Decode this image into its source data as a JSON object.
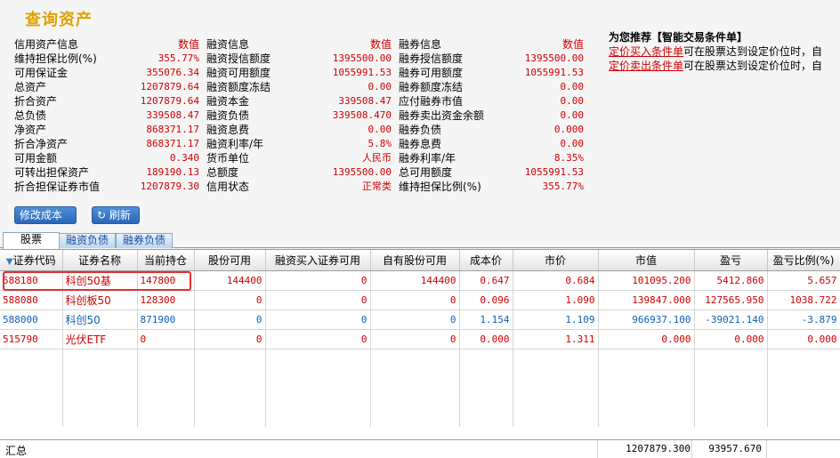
{
  "page_title": "查询资产",
  "credit_info": [
    {
      "label": "信用资产信息",
      "value": "数值",
      "red": true
    },
    {
      "label": "维持担保比例(%)",
      "value": "355.77%"
    },
    {
      "label": "可用保证金",
      "value": "355076.34"
    },
    {
      "label": "总资产",
      "value": "1207879.64"
    },
    {
      "label": "折合资产",
      "value": "1207879.64"
    },
    {
      "label": "总负债",
      "value": "339508.47"
    },
    {
      "label": "净资产",
      "value": "868371.17"
    },
    {
      "label": "折合净资产",
      "value": "868371.17"
    },
    {
      "label": "可用金额",
      "value": "0.340"
    },
    {
      "label": "可转出担保资产",
      "value": "189190.13"
    },
    {
      "label": "折合担保证券市值",
      "value": "1207879.30"
    }
  ],
  "margin_info": [
    {
      "label": "融资信息",
      "value": "数值"
    },
    {
      "label": "融资授信额度",
      "value": "1395500.00"
    },
    {
      "label": "融资可用额度",
      "value": "1055991.53"
    },
    {
      "label": "融资额度冻结",
      "value": "0.00"
    },
    {
      "label": "融资本金",
      "value": "339508.47"
    },
    {
      "label": "融资负债",
      "value": "339508.470"
    },
    {
      "label": "融资息费",
      "value": "0.00"
    },
    {
      "label": "融资利率/年",
      "value": "5.8%"
    },
    {
      "label": "货币单位",
      "value": "人民币"
    },
    {
      "label": "总额度",
      "value": "1395500.00"
    },
    {
      "label": "信用状态",
      "value": "正常类"
    }
  ],
  "short_info": [
    {
      "label": "融券信息",
      "value": "数值"
    },
    {
      "label": "融券授信额度",
      "value": "1395500.00"
    },
    {
      "label": "融券可用额度",
      "value": "1055991.53"
    },
    {
      "label": "融券额度冻结",
      "value": "0.00"
    },
    {
      "label": "应付融券市值",
      "value": "0.00"
    },
    {
      "label": "融券卖出资金余额",
      "value": "0.00"
    },
    {
      "label": "融券负债",
      "value": "0.000"
    },
    {
      "label": "融券息费",
      "value": "0.00"
    },
    {
      "label": "融券利率/年",
      "value": "8.35%"
    },
    {
      "label": "总可用额度",
      "value": "1055991.53"
    },
    {
      "label": "维持担保比例(%)",
      "value": "355.77%"
    }
  ],
  "promo": {
    "title": "为您推荐【智能交易条件单】",
    "buy_link": "定价买入条件单",
    "buy_text": "可在股票达到设定价位时，自",
    "sell_link": "定价卖出条件单",
    "sell_text": "可在股票达到设定价位时，自"
  },
  "buttons": {
    "modify_cost": "修改成本价",
    "refresh": "刷新"
  },
  "tabs": [
    "股票",
    "融资负债",
    "融券负债"
  ],
  "columns": [
    "证券代码",
    "证券名称",
    "当前持仓",
    "股份可用",
    "融资买入证券可用",
    "自有股份可用",
    "成本价",
    "市价",
    "市值",
    "盈亏",
    "盈亏比例(%)"
  ],
  "rows": [
    {
      "color": "red",
      "cells": [
        "588180",
        "科创50基",
        "147800",
        "144400",
        "0",
        "144400",
        "0.647",
        "0.684",
        "101095.200",
        "5412.860",
        "5.657"
      ]
    },
    {
      "color": "red",
      "cells": [
        "588080",
        "科创板50",
        "128300",
        "0",
        "0",
        "0",
        "0.096",
        "1.090",
        "139847.000",
        "127565.950",
        "1038.722"
      ]
    },
    {
      "color": "blue",
      "cells": [
        "588000",
        "科创50",
        "871900",
        "0",
        "0",
        "0",
        "1.154",
        "1.109",
        "966937.100",
        "-39021.140",
        "-3.879"
      ]
    },
    {
      "color": "red",
      "cells": [
        "515790",
        "光伏ETF",
        "0",
        "0",
        "0",
        "0",
        "0.000",
        "1.311",
        "0.000",
        "0.000",
        "0.000"
      ]
    }
  ],
  "summary": {
    "label": "汇总",
    "market_value": "1207879.300",
    "profit_loss": "93957.670"
  },
  "colors": {
    "title": "#e0a000",
    "value_red": "#d00000",
    "blue": "#1060b0",
    "button": "#2a66b8",
    "highlight": "#e03030"
  }
}
